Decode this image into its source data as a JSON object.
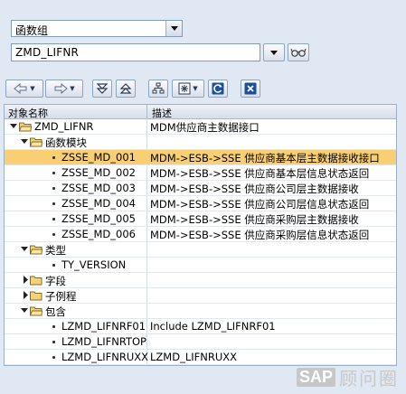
{
  "object_selector": {
    "type_value": "函数组",
    "name_value": "ZMD_LIFNR"
  },
  "toolbar": {
    "icons": [
      "back-icon",
      "forward-icon",
      "expand-icon",
      "collapse-icon",
      "hierarchy-icon",
      "display-icon",
      "refresh-icon",
      "close-icon"
    ]
  },
  "tree": {
    "headers": {
      "name": "对象名称",
      "desc": "描述"
    },
    "rows": [
      {
        "name": "ZMD_LIFNR",
        "desc": "MDM供应商主数据接口"
      },
      {
        "name": "函数模块",
        "desc": ""
      },
      {
        "name": "ZSSE_MD_001",
        "desc": "MDM->ESB->SSE  供应商基本层主数据接收接口",
        "selected": true
      },
      {
        "name": "ZSSE_MD_002",
        "desc": "MDM->ESB->SSE  供应商基本层信息状态返回"
      },
      {
        "name": "ZSSE_MD_003",
        "desc": "MDM->ESB->SSE  供应商公司层主数据接收"
      },
      {
        "name": "ZSSE_MD_004",
        "desc": "MDM->ESB->SSE  供应商公司层信息状态返回"
      },
      {
        "name": "ZSSE_MD_005",
        "desc": "MDM->ESB->SSE  供应商采购层主数据接收"
      },
      {
        "name": "ZSSE_MD_006",
        "desc": "MDM->ESB->SSE  供应商采购层信息状态返回"
      },
      {
        "name": "类型",
        "desc": ""
      },
      {
        "name": "TY_VERSION",
        "desc": ""
      },
      {
        "name": "字段",
        "desc": ""
      },
      {
        "name": "子例程",
        "desc": ""
      },
      {
        "name": "包含",
        "desc": ""
      },
      {
        "name": "LZMD_LIFNRF01",
        "desc": "Include LZMD_LIFNRF01"
      },
      {
        "name": "LZMD_LIFNRTOP",
        "desc": ""
      },
      {
        "name": "LZMD_LIFNRUXX",
        "desc": "LZMD_LIFNRUXX"
      }
    ]
  },
  "watermark": {
    "brand": "SAP",
    "text": "顾问圈"
  },
  "colors": {
    "selection": "#f9cf74",
    "panel": "#dfe8f3"
  }
}
